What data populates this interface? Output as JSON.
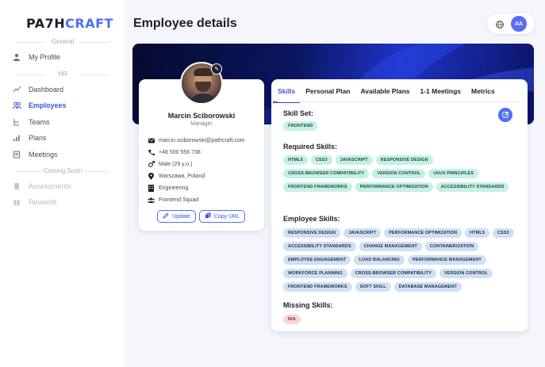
{
  "brand": {
    "part1": "PA7H",
    "part2": "CRAFT"
  },
  "sidebar": {
    "sections": [
      "General",
      "HR",
      "Coming Soon"
    ],
    "general": [
      {
        "label": "My Profile",
        "icon": "person-icon"
      }
    ],
    "hr": [
      {
        "label": "Dashboard",
        "icon": "dashboard-icon"
      },
      {
        "label": "Employees",
        "icon": "employees-icon"
      },
      {
        "label": "Teams",
        "icon": "teams-icon"
      },
      {
        "label": "Plans",
        "icon": "plans-icon"
      },
      {
        "label": "Meetings",
        "icon": "meetings-icon"
      }
    ],
    "soon": [
      {
        "label": "Assessments",
        "icon": "assessments-icon"
      },
      {
        "label": "Rewards",
        "icon": "rewards-icon"
      }
    ],
    "active": "Employees"
  },
  "header": {
    "title": "Employee details",
    "user_initials": "AA"
  },
  "profile": {
    "name": "Marcin Sciborowski",
    "role": "Manager",
    "email": "marcin.sciborowski@pathcraft.com",
    "phone": "+48 500 556 738",
    "gender": "Male (29 y.o.)",
    "location": "Warszawa, Poland",
    "department": "Engineering",
    "team": "Frontend Squad",
    "update_label": "Update",
    "copy_url_label": "Copy URL"
  },
  "tabs": [
    "Skills",
    "Personal Plan",
    "Available Plans",
    "1-1 Meetings",
    "Metrics"
  ],
  "active_tab": "Skills",
  "skills": {
    "skill_set_title": "Skill Set:",
    "skill_set": [
      "FRONTEND"
    ],
    "required_title": "Required Skills:",
    "required": [
      "HTML5",
      "CSS3",
      "JAVASCRIPT",
      "RESPONSIVE DESIGN",
      "CROSS-BROWSER COMPATIBILITY",
      "VERSION CONTROL",
      "UI/UX PRINCIPLES",
      "FRONTEND FRAMEWORKS",
      "PERFORMANCE OPTIMIZATION",
      "ACCESSIBILITY STANDARDS"
    ],
    "employee_title": "Employee Skills:",
    "employee": [
      "RESPONSIVE DESIGN",
      "JAVASCRIPT",
      "PERFORMANCE OPTIMIZATION",
      "HTML5",
      "CSS3",
      "ACCESSIBILITY STANDARDS",
      "CHANGE MANAGEMENT",
      "CONTAINERIZATION",
      "EMPLOYEE ENGAGEMENT",
      "LOAD BALANCING",
      "PERFORMANCE MANAGEMENT",
      "WORKFORCE PLANNING",
      "CROSS-BROWSER COMPATIBILITY",
      "VERSION CONTROL",
      "FRONTEND FRAMEWORKS",
      "SOFT SKILL",
      "DATABASE MANAGEMENT"
    ],
    "missing_title": "Missing Skills:",
    "missing": [
      "N/A"
    ]
  },
  "colors": {
    "accent": "#4f6ef7",
    "green_tag": "#c5f0e6",
    "blue_tag": "#cfe0f5",
    "red_tag": "#f8d5d5"
  }
}
